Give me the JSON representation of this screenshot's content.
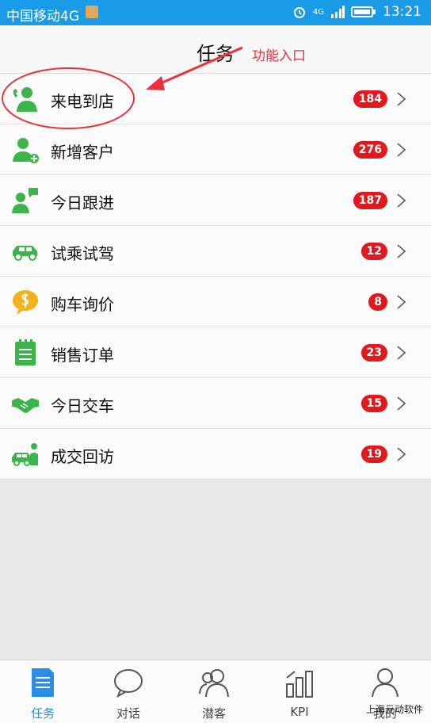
{
  "status_bar": {
    "carrier": "中国移动4G",
    "network": "4G",
    "time": "13:21"
  },
  "header": {
    "title": "任务",
    "annotation": "功能入口"
  },
  "colors": {
    "accent": "#1a9be8",
    "badge": "#e3171e",
    "icon_green": "#3bb54a",
    "annotation": "#e8333a",
    "active_tab": "#2a8ee8"
  },
  "tasks": [
    {
      "label": "来电到店",
      "count": "184",
      "icon": "phone-person-icon"
    },
    {
      "label": "新增客户",
      "count": "276",
      "icon": "add-customer-icon"
    },
    {
      "label": "今日跟进",
      "count": "187",
      "icon": "follow-up-chat-icon"
    },
    {
      "label": "试乘试驾",
      "count": "12",
      "icon": "car-icon"
    },
    {
      "label": "购车询价",
      "count": "8",
      "icon": "price-bubble-icon"
    },
    {
      "label": "销售订单",
      "count": "23",
      "icon": "order-list-icon"
    },
    {
      "label": "今日交车",
      "count": "15",
      "icon": "handshake-icon"
    },
    {
      "label": "成交回访",
      "count": "19",
      "icon": "revisit-car-icon"
    }
  ],
  "tabs": [
    {
      "label": "任务",
      "icon": "task-document-icon",
      "active": true
    },
    {
      "label": "对话",
      "icon": "chat-bubble-icon",
      "active": false
    },
    {
      "label": "潜客",
      "icon": "prospects-people-icon",
      "active": false
    },
    {
      "label": "KPI",
      "icon": "kpi-chart-icon",
      "active": false
    },
    {
      "label": "我的",
      "icon": "profile-person-icon",
      "active": false
    }
  ],
  "watermark": "上海元动软件"
}
